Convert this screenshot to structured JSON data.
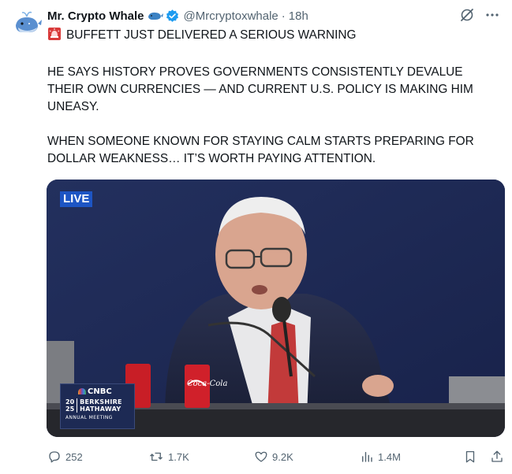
{
  "post": {
    "author_name": "Mr. Crypto Whale",
    "handle": "@Mrcryptoxwhale",
    "separator": "·",
    "time": "18h",
    "line1": "BUFFETT JUST DELIVERED A SERIOUS WARNING",
    "para2_line1": "HE SAYS HISTORY PROVES GOVERNMENTS CONSISTENTLY DEVALUE",
    "para2_line2": "THEIR OWN CURRENCIES — AND CURRENT U.S. POLICY IS MAKING HIM",
    "para2_line3": "UNEASY.",
    "para3_line1": "WHEN SOMEONE KNOWN FOR STAYING CALM STARTS PREPARING FOR",
    "para3_line2": "DOLLAR WEAKNESS… IT’S WORTH PAYING ATTENTION."
  },
  "media": {
    "live_label": "LIVE",
    "network": "CNBC",
    "event_year_top": "20",
    "event_year_bottom": "25",
    "event_name_top": "BERKSHIRE",
    "event_name_bottom": "HATHAWAY",
    "event_subtitle": "ANNUAL MEETING",
    "can_label": "Coca-Cola"
  },
  "stats": {
    "replies": "252",
    "reposts": "1.7K",
    "likes": "9.2K",
    "views": "1.4M"
  },
  "icons": {
    "verified": "verified-badge-icon",
    "emoji_name": "whale-emoji-icon",
    "emoji_text": "siren-emoji-icon",
    "grok": "grok-icon",
    "more": "more-icon",
    "reply": "reply-icon",
    "repost": "repost-icon",
    "like": "heart-icon",
    "views": "views-icon",
    "bookmark": "bookmark-icon",
    "share": "share-icon"
  },
  "colors": {
    "text": "#0f1419",
    "secondary": "#536471",
    "verified": "#1d9bf0",
    "live_badge": "#1d55c4"
  }
}
